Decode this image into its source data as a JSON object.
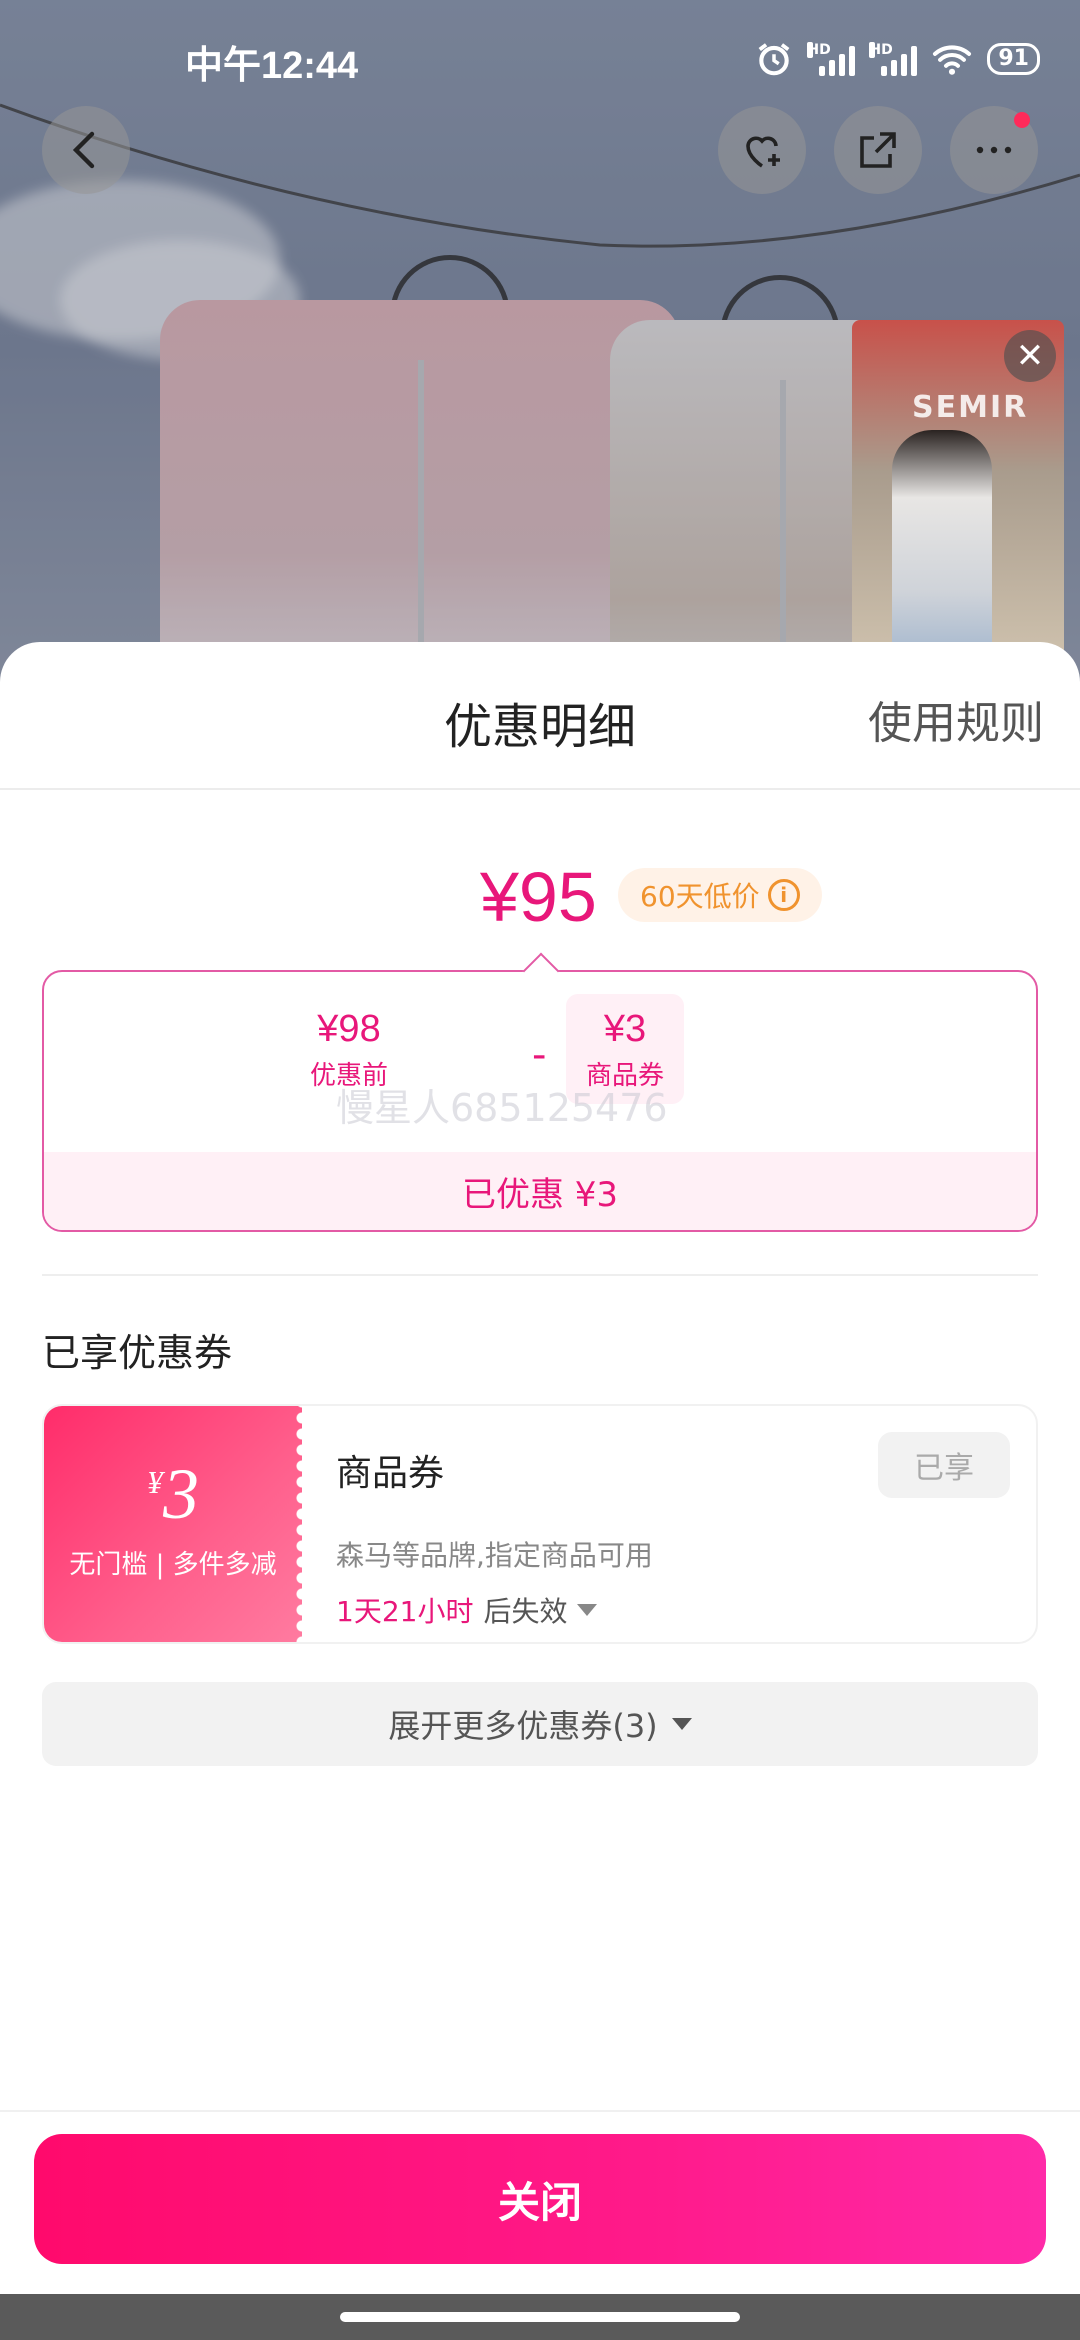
{
  "status_bar": {
    "time": "中午12:44",
    "battery": "91",
    "signal_tag": "HD"
  },
  "sheet": {
    "title": "优惠明细",
    "rules_link": "使用规则",
    "final_price": "¥95",
    "low_price_badge": "60天低价",
    "calc": {
      "original_amount": "¥98",
      "original_label": "优惠前",
      "operator": "-",
      "coupon_amount": "¥3",
      "coupon_label": "商品券",
      "watermark": "慢星人685125476",
      "saved_text": "已优惠 ¥3"
    },
    "section_title": "已享优惠券",
    "coupon": {
      "symbol": "¥",
      "amount": "3",
      "condition": "无门槛 | 多件多减",
      "name": "商品券",
      "status": "已享",
      "description": "森马等品牌,指定商品可用",
      "expire_highlight": "1天21小时",
      "expire_suffix": "后失效"
    },
    "expand_label": "展开更多优惠券(3)",
    "close_label": "关闭"
  },
  "live_card": {
    "brand": "SEMIR"
  },
  "colors": {
    "accent": "#e8177a",
    "button": "#ff0a6c",
    "badge": "#f0932e"
  }
}
